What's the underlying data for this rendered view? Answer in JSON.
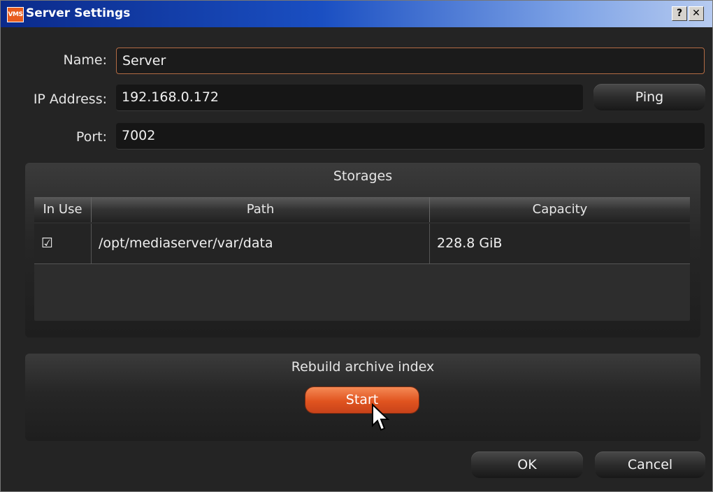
{
  "window": {
    "app_icon_text": "VMS",
    "title": "Server Settings",
    "help_label": "?",
    "close_label": "✕"
  },
  "form": {
    "name_label": "Name:",
    "name_value": "Server",
    "ip_label": "IP Address:",
    "ip_value": "192.168.0.172",
    "ping_label": "Ping",
    "port_label": "Port:",
    "port_value": "7002"
  },
  "storages": {
    "title": "Storages",
    "columns": [
      "In Use",
      "Path",
      "Capacity"
    ],
    "rows": [
      {
        "in_use": true,
        "check_glyph": "☑",
        "path": "/opt/mediaserver/var/data",
        "capacity": "228.8 GiB"
      }
    ]
  },
  "rebuild": {
    "title": "Rebuild archive index",
    "start_label": "Start"
  },
  "footer": {
    "ok_label": "OK",
    "cancel_label": "Cancel"
  }
}
